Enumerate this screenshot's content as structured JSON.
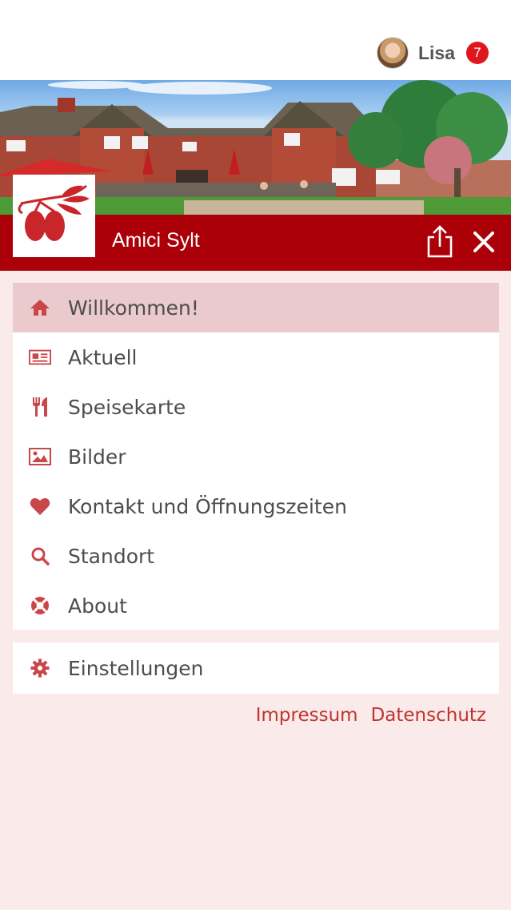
{
  "user": {
    "name": "Lisa",
    "notification_count": "7"
  },
  "header": {
    "title": "Amici Sylt"
  },
  "menu": {
    "items": [
      {
        "label": "Willkommen!",
        "icon": "home-icon"
      },
      {
        "label": "Aktuell",
        "icon": "newspaper-icon"
      },
      {
        "label": "Speisekarte",
        "icon": "cutlery-icon"
      },
      {
        "label": "Bilder",
        "icon": "image-icon"
      },
      {
        "label": "Kontakt und Öffnungszeiten",
        "icon": "heart-icon"
      },
      {
        "label": "Standort",
        "icon": "search-icon"
      },
      {
        "label": "About",
        "icon": "about-icon"
      }
    ],
    "settings": {
      "label": "Einstellungen",
      "icon": "gear-icon"
    }
  },
  "footer": {
    "impressum": "Impressum",
    "datenschutz": "Datenschutz"
  },
  "colors": {
    "brand": "#ab0008",
    "accent": "#c0342f",
    "active_bg": "#ebcacd",
    "page_bg": "#fbeaea",
    "badge": "#e0151d"
  }
}
